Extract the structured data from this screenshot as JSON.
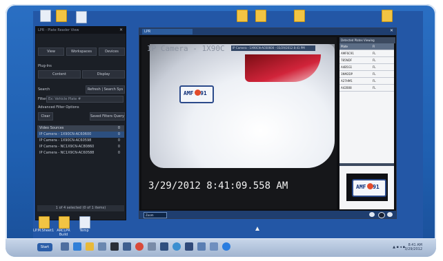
{
  "desktop": {
    "top_icons": [
      "folder",
      "folder",
      "folder",
      "folder",
      "folder",
      "folder"
    ],
    "bottom_icons": [
      {
        "label": "LP.M.Sheet1"
      },
      {
        "label": "ARCLPR Build"
      },
      {
        "label": "Temp"
      }
    ]
  },
  "panel": {
    "title": "LPR - Plate Reader View",
    "menu": [
      "View",
      "Workspaces",
      "Devices"
    ],
    "section_plugins": "Plug-Ins",
    "buttons": {
      "content": "Content",
      "display": "Display"
    },
    "search_label": "Search",
    "refresh_button": "Refresh | Search Sys",
    "filter_label": "Filter",
    "filter_value": "Ex: Vehicle Plate #",
    "advanced": "Advanced Filter Options",
    "clear": "Clear",
    "saved_filters": "Saved Filters Query",
    "list_header": "Video Sources",
    "list_header_count": "0",
    "sources": [
      {
        "name": "IP Camera - 1X90CN-AC60600",
        "count": "0",
        "selected": true
      },
      {
        "name": "IP Camera - 1X90CN-AC60598",
        "count": "0",
        "selected": false
      },
      {
        "name": "IP Camera - NC1X9CN-AC80860",
        "count": "0",
        "selected": false
      },
      {
        "name": "IP Camera - NC1X9CN-AC60588",
        "count": "0",
        "selected": false
      }
    ],
    "status": "1 of 4 selected (0 of 1 items)"
  },
  "viewer": {
    "tab_label": "LPR",
    "video_caption": "IP Camera - 1X90CN-AC60600 - 03/29/2012 8:41 PM",
    "camera_overlay": "IP Camera - 1X90C",
    "timestamp": "3/29/2012    8:41:09.558 AM",
    "plate_text": "AMF C91",
    "zoom_label": "Zoom",
    "side_header": "Detected Plates Viewing",
    "side_columns": [
      "Plate",
      "Fl"
    ],
    "side_rows": [
      {
        "plate": "AMF6C91",
        "flag": "FL"
      },
      {
        "plate": "785NDF",
        "flag": "FL"
      },
      {
        "plate": "A4B5G1",
        "flag": "FL"
      },
      {
        "plate": "1NM2DP",
        "flag": "FL"
      },
      {
        "plate": "A27HM1",
        "flag": "FL"
      },
      {
        "plate": "A42B08",
        "flag": "FL"
      }
    ]
  },
  "taskbar": {
    "start_label": "Start",
    "clock_time": "8:41 AM",
    "clock_date": "3/29/2012"
  },
  "colors": {
    "desktop_bg": "#2357a6",
    "accent": "#1f3e6f",
    "taillight": "#d1243a"
  }
}
